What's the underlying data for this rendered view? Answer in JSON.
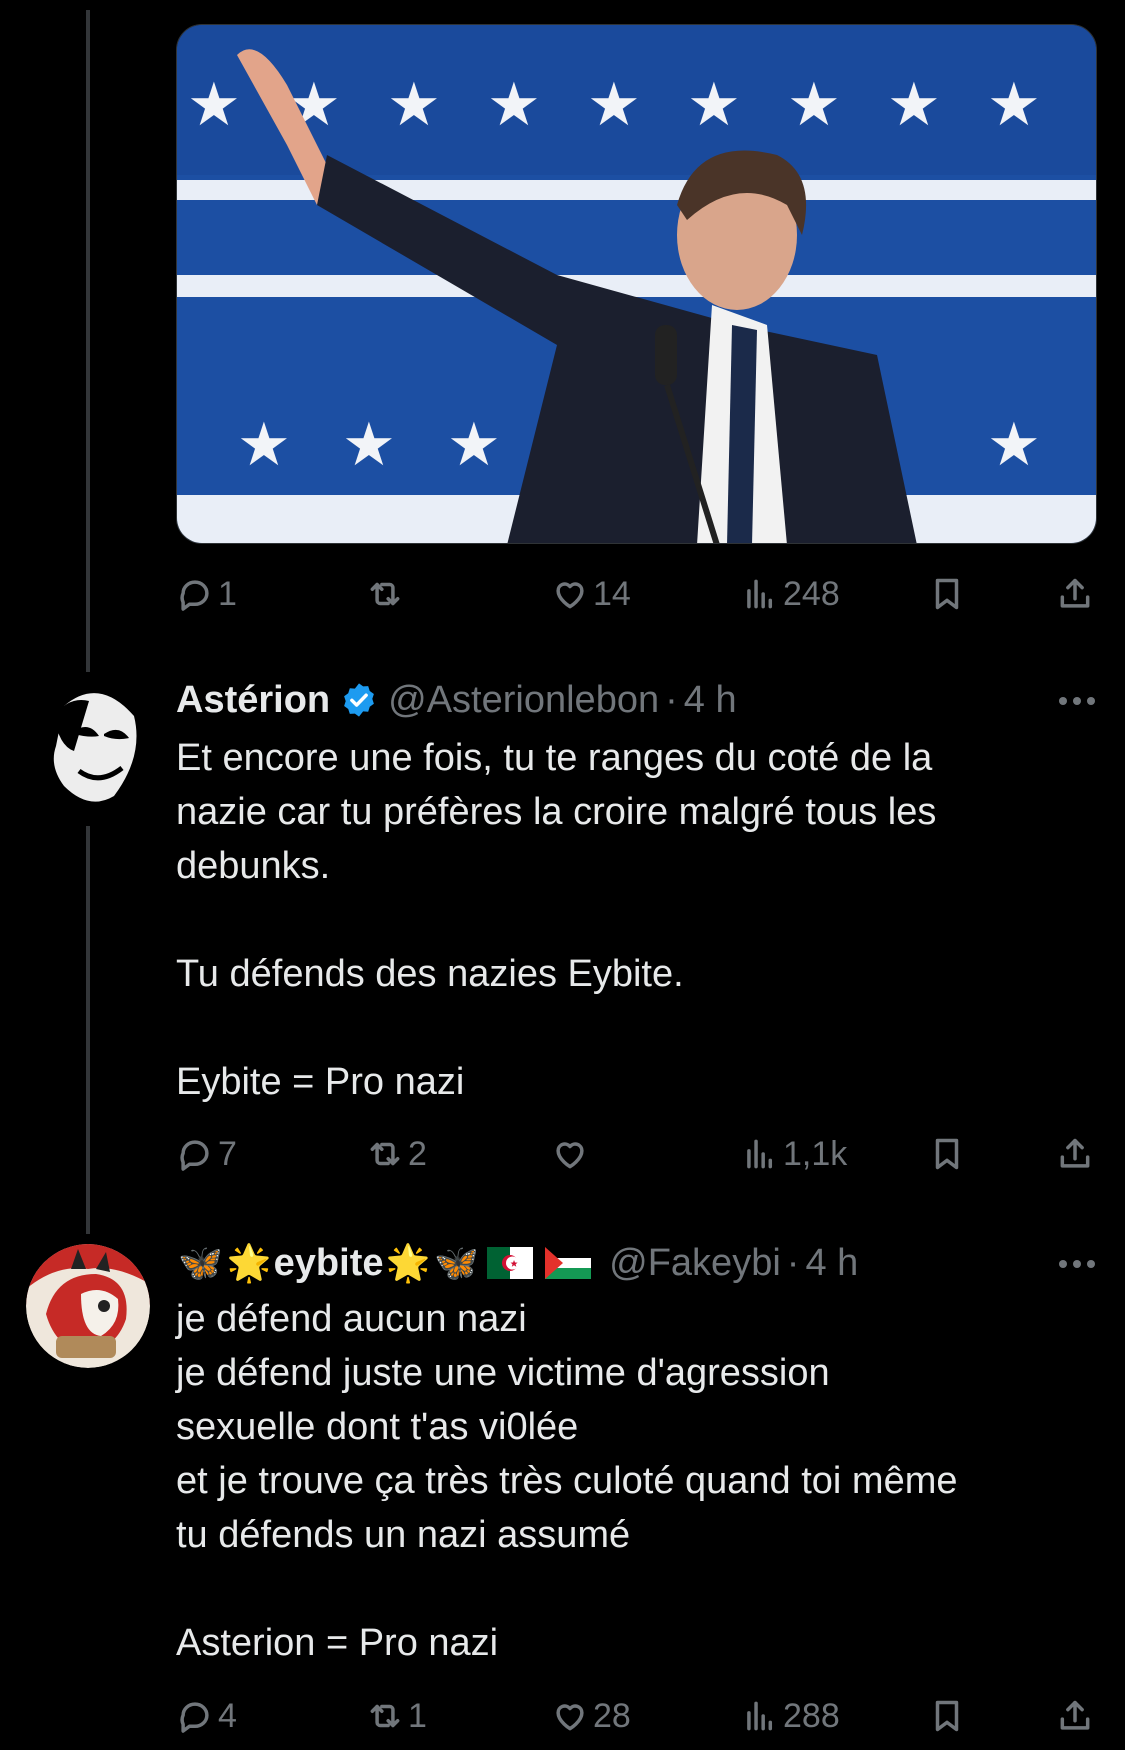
{
  "tweet_top": {
    "media_description": "",
    "actions": {
      "replies": "1",
      "retweets": "",
      "likes": "14",
      "views": "248"
    }
  },
  "tweet_asterion": {
    "name": "Astérion",
    "handle": "@Asterionlebon",
    "time": "4 h",
    "text": "Et encore une fois, tu te ranges du coté de la\nnazie car tu préfères la croire malgré tous les\ndebunks.\n\nTu défends des nazies Eybite.\n\nEybite = Pro nazi",
    "actions": {
      "replies": "7",
      "retweets": "2",
      "likes": "",
      "views": "1,1k"
    }
  },
  "tweet_eybite": {
    "name_prefix": "🦋 🌟",
    "name": "eybite",
    "name_suffix": "🌟 🦋",
    "handle": "@Fakeybi",
    "time": "4 h",
    "text": "je défend aucun nazi\nje défend juste une victime d'agression\nsexuelle dont t'as vi0lée\net je trouve ça très très culoté quand toi même\ntu défends un nazi assumé\n\nAsterion = Pro nazi",
    "actions": {
      "replies": "4",
      "retweets": "1",
      "likes": "28",
      "views": "288"
    }
  },
  "icons": {
    "reply": "reply-icon",
    "retweet": "retweet-icon",
    "like": "heart-icon",
    "views": "views-icon",
    "bookmark": "bookmark-icon",
    "share": "share-icon",
    "verified": "verified-badge-icon",
    "more": "more-icon"
  },
  "colors": {
    "background": "#000000",
    "text": "#e7e9ea",
    "secondary": "#71767b",
    "verified": "#1d9bf0",
    "thread_line": "#333639"
  }
}
